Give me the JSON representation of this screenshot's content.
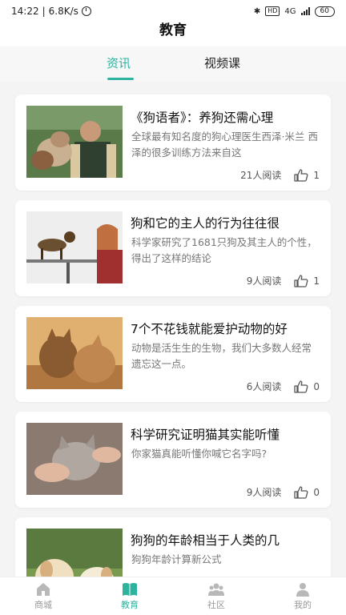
{
  "status_bar": {
    "time": "14:22",
    "speed": "6.8K/s",
    "network": "4G",
    "hd": "HD",
    "battery": "60"
  },
  "header": {
    "title": "教育"
  },
  "tabs": [
    {
      "label": "资讯",
      "active": true
    },
    {
      "label": "视频课",
      "active": false
    }
  ],
  "articles": [
    {
      "title": "《狗语者》：养狗还需心理",
      "summary": "全球最有知名度的狗心理医生西泽·米兰 西泽的很多训练方法来自这",
      "reads": "21人阅读",
      "likes": "1",
      "image": "man-with-dogs"
    },
    {
      "title": "狗和它的主人的行为往往很",
      "summary": "科学家研究了1681只狗及其主人的个性，得出了这样的结论",
      "reads": "9人阅读",
      "likes": "1",
      "image": "woman-and-dog"
    },
    {
      "title": "7个不花钱就能爱护动物的好",
      "summary": "动物是活生生的生物，我们大多数人经常遗忘这一点。",
      "reads": "6人阅读",
      "likes": "0",
      "image": "two-cats"
    },
    {
      "title": "科学研究证明猫其实能听懂",
      "summary": "你家猫真能听懂你喊它名字吗?",
      "reads": "9人阅读",
      "likes": "0",
      "image": "cat-petted"
    },
    {
      "title": "狗狗的年龄相当于人类的几",
      "summary": "狗狗年龄计算新公式",
      "reads": "",
      "likes": "",
      "image": "puppies"
    }
  ],
  "bottom_nav": [
    {
      "label": "商城",
      "icon": "home-icon",
      "active": false
    },
    {
      "label": "教育",
      "icon": "book-icon",
      "active": true
    },
    {
      "label": "社区",
      "icon": "community-icon",
      "active": false
    },
    {
      "label": "我的",
      "icon": "user-icon",
      "active": false
    }
  ],
  "colors": {
    "accent": "#2db39e",
    "background": "#f4f4f4"
  }
}
